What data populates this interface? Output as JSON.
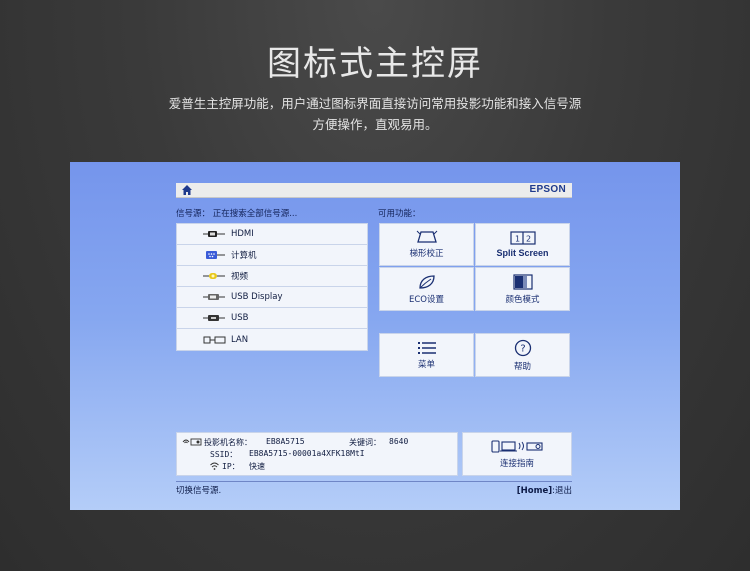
{
  "page": {
    "title": "图标式主控屏",
    "subtitle_line1": "爱普生主控屏功能，用户通过图标界面直接访问常用投影功能和接入信号源",
    "subtitle_line2": "方便操作，直观易用。"
  },
  "screen": {
    "brand": "EPSON",
    "source_header": "信号源：  正在搜索全部信号源...",
    "functions_header": "可用功能：",
    "sources": [
      {
        "label": "HDMI",
        "icon": "hdmi-icon"
      },
      {
        "label": "计算机",
        "icon": "vga-icon"
      },
      {
        "label": "视频",
        "icon": "video-icon"
      },
      {
        "label": "USB Display",
        "icon": "usb-display-icon"
      },
      {
        "label": "USB",
        "icon": "usb-icon"
      },
      {
        "label": "LAN",
        "icon": "lan-icon"
      }
    ],
    "functions": [
      {
        "label": "梯形校正",
        "icon": "keystone-icon"
      },
      {
        "label": "Split Screen",
        "icon": "split-screen-icon"
      },
      {
        "label": "ECO设置",
        "icon": "eco-leaf-icon"
      },
      {
        "label": "颜色模式",
        "icon": "color-mode-icon"
      },
      {
        "label": "菜单",
        "icon": "menu-list-icon"
      },
      {
        "label": "帮助",
        "icon": "help-icon"
      }
    ],
    "info": {
      "name_label": "投影机名称：",
      "name_value": "EB8A5715",
      "keyword_label": "关键词：",
      "keyword_value": "8640",
      "ssid_label": "SSID：",
      "ssid_value": "EB8A5715-00001a4XFK18MtI",
      "ip_label": "IP：",
      "ip_value": "快速"
    },
    "connect_label": "连接指南",
    "status_left": "切换信号源.",
    "status_key": "[Home]",
    "status_right": ":退出"
  },
  "colors": {
    "screen_top": "#7595ec",
    "screen_bottom": "#b4cdf8",
    "accent_text": "#1a2f72"
  }
}
